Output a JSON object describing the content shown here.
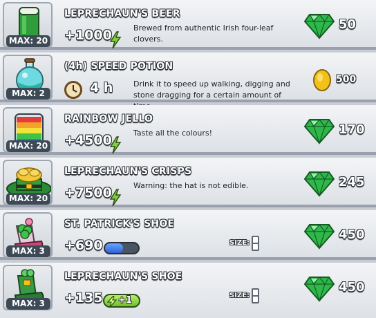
{
  "items": [
    {
      "title": "LEPRECHAUN'S BEER",
      "max": "MAX: 20",
      "stat": "+1000",
      "desc": "Brewed from authentic Irish four-leaf clovers.",
      "price": "50",
      "currency": "gem-icon",
      "image": "beer-icon"
    },
    {
      "title": "(4h) SPEED POTION",
      "max": "MAX: 2",
      "stat": "4 h",
      "desc": "Drink it to speed up walking, digging and stone dragging for a certain amount of time.",
      "price": "500",
      "currency": "coin-icon",
      "image": "potion-icon"
    },
    {
      "title": "RAINBOW JELLO",
      "max": "MAX: 20",
      "stat": "+4500",
      "desc": "Taste all the colours!",
      "price": "170",
      "currency": "gem-icon",
      "image": "jello-icon"
    },
    {
      "title": "LEPRECHAUN'S CRISPS",
      "max": "MAX: 20",
      "stat": "+7500",
      "desc": "Warning: the hat is not edible.",
      "price": "245",
      "currency": "gem-icon",
      "image": "crisps-icon"
    },
    {
      "title": "ST. PATRICK'S SHOE",
      "max": "MAX: 3",
      "stat": "+690",
      "size_label": "SIZE:",
      "energy_fill": 0.55,
      "price": "450",
      "currency": "gem-icon",
      "image": "shoe-icon"
    },
    {
      "title": "LEPRECHAUN'S SHOE",
      "max": "MAX: 3",
      "stat": "+135",
      "bonus": "+1",
      "size_label": "SIZE:",
      "price": "450",
      "currency": "gem-icon",
      "image": "green-shoe-icon"
    }
  ],
  "colors": {
    "gem": "#2fb84a",
    "coin": "#f2c21a",
    "energy": "#7fd13a",
    "accent_blue": "#3b73e0"
  }
}
